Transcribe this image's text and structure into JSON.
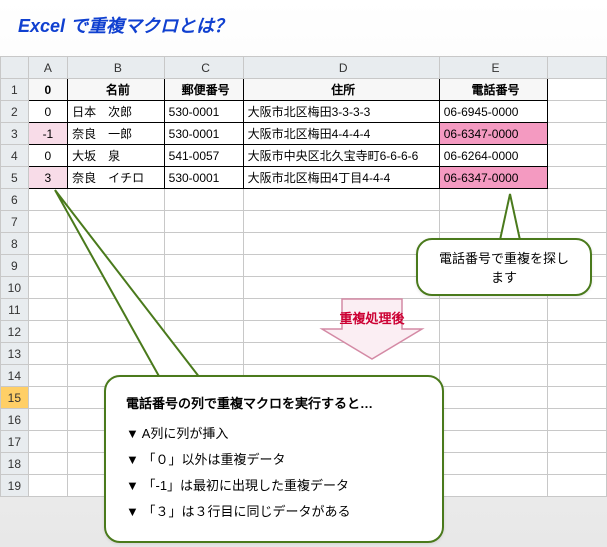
{
  "title": "Excel で重複マクロとは？",
  "columns": [
    "A",
    "B",
    "C",
    "D",
    "E"
  ],
  "header_row": {
    "A": "0",
    "B": "名前",
    "C": "郵便番号",
    "D": "住所",
    "E": "電話番号"
  },
  "rows": [
    {
      "A": "0",
      "B": "日本　次郎",
      "C": "530-0001",
      "D": "大阪市北区梅田3-3-3-3",
      "E": "06-6945-0000",
      "hlA": false,
      "hlE": false
    },
    {
      "A": "-1",
      "B": "奈良　一郎",
      "C": "530-0001",
      "D": "大阪市北区梅田4-4-4-4",
      "E": "06-6347-0000",
      "hlA": true,
      "hlE": true
    },
    {
      "A": "0",
      "B": "大坂　泉",
      "C": "541-0057",
      "D": "大阪市中央区北久宝寺町6-6-6-6",
      "E": "06-6264-0000",
      "hlA": false,
      "hlE": false
    },
    {
      "A": "3",
      "B": "奈良　イチロ",
      "C": "530-0001",
      "D": "大阪市北区梅田4丁目4-4-4",
      "E": "06-6347-0000",
      "hlA": true,
      "hlE": true
    }
  ],
  "callout1": "電話番号で重複を探します",
  "callout2": {
    "head": "電話番号の列で重複マクロを実行すると…",
    "items": [
      "A列に列が挿入",
      "「０」以外は重複データ",
      "「-1」は最初に出現した重複データ",
      "「３」は３行目に同じデータがある"
    ]
  },
  "arrow_label": "重複処理後"
}
